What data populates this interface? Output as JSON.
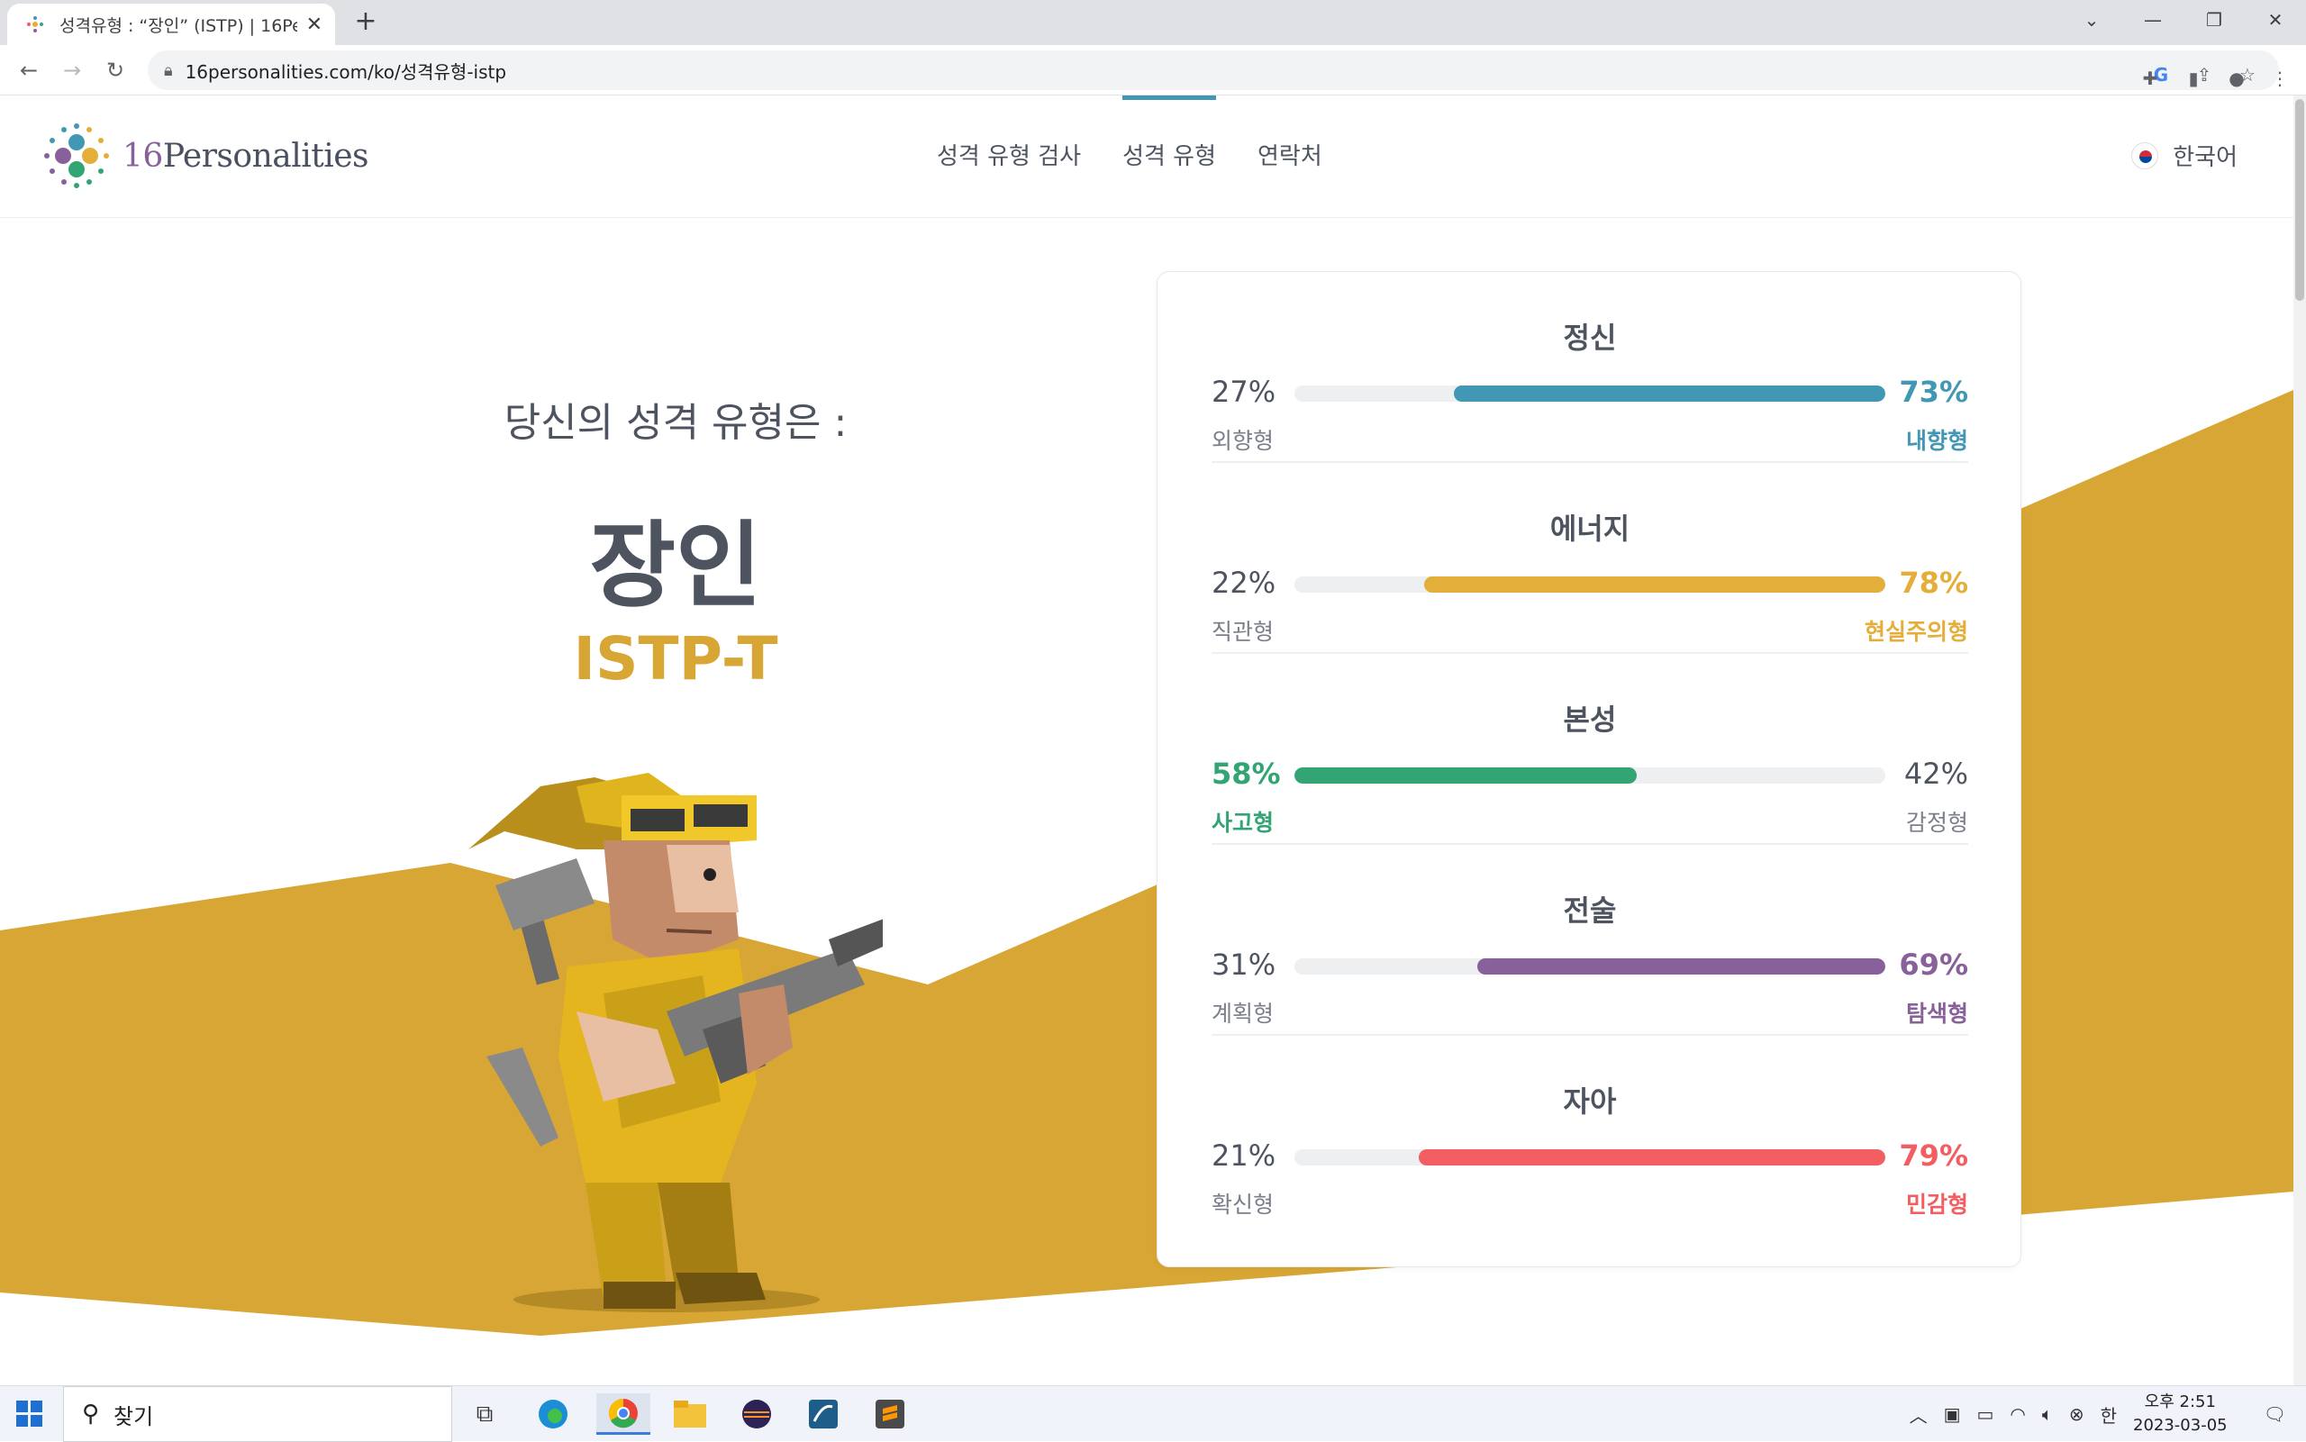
{
  "browser": {
    "tab_title": "성격유형 : “장인” (ISTP) | 16Personalities",
    "url": "16personalities.com/ko/성격유형-istp"
  },
  "site": {
    "brand_number": "16",
    "brand_text": "Personalities",
    "nav": [
      "성격 유형 검사",
      "성격 유형",
      "연락처"
    ],
    "active_nav": "성격 유형",
    "language": "한국어"
  },
  "hero": {
    "intro": "당신의 성격 유형은 :",
    "type_name": "장인",
    "type_code": "ISTP-T"
  },
  "traits": [
    {
      "title": "정신",
      "left_pct": "27%",
      "right_pct": "73%",
      "left_label": "외향형",
      "right_label": "내향형",
      "dominant": "right",
      "value": 73,
      "color": "#4298b4"
    },
    {
      "title": "에너지",
      "left_pct": "22%",
      "right_pct": "78%",
      "left_label": "직관형",
      "right_label": "현실주의형",
      "dominant": "right",
      "value": 78,
      "color": "#e4ae3a"
    },
    {
      "title": "본성",
      "left_pct": "58%",
      "right_pct": "42%",
      "left_label": "사고형",
      "right_label": "감정형",
      "dominant": "left",
      "value": 58,
      "color": "#33a474"
    },
    {
      "title": "전술",
      "left_pct": "31%",
      "right_pct": "69%",
      "left_label": "계획형",
      "right_label": "탐색형",
      "dominant": "right",
      "value": 69,
      "color": "#88619a"
    },
    {
      "title": "자아",
      "left_pct": "21%",
      "right_pct": "79%",
      "left_label": "확신형",
      "right_label": "민감형",
      "dominant": "right",
      "value": 79,
      "color": "#f25e62"
    }
  ],
  "taskbar": {
    "search_text": "찾기",
    "time": "오후 2:51",
    "date": "2023-03-05",
    "ime": "한"
  },
  "colors": {
    "accent_blue": "#4298b4",
    "gold": "#d8a634",
    "text_dark": "#4d5460"
  }
}
